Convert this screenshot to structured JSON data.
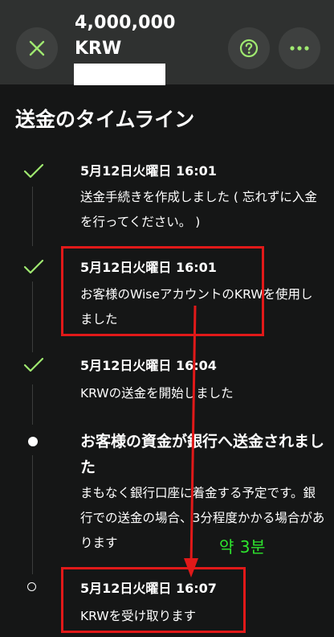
{
  "header": {
    "amount": "4,000,000",
    "currency": "KRW",
    "close_icon": "close-x-icon",
    "help_icon": "question-mark-icon",
    "more_icon": "more-dots-icon",
    "accent_color": "#9fe870"
  },
  "timeline": {
    "title": "送金のタイムライン",
    "steps": [
      {
        "status": "done",
        "time": "5月12日火曜日 16:01",
        "text": "送金手続きを作成しました ( 忘れずに入金を行ってください。 )"
      },
      {
        "status": "done",
        "time": "5月12日火曜日 16:01",
        "text": "お客様のWiseアカウントのKRWを使用しました"
      },
      {
        "status": "done",
        "time": "5月12日火曜日 16:04",
        "text": "KRWの送金を開始しました"
      },
      {
        "status": "current",
        "heading": "お客様の資金が銀行へ送金されました",
        "text": "まもなく銀行口座に着金する予定です。銀行での送金の場合、3分程度かかる場合があります"
      },
      {
        "status": "pending",
        "time": "5月12日火曜日 16:07",
        "text": "KRWを受け取ります"
      }
    ]
  },
  "annotation": {
    "note": "약 3분",
    "color": "#e11919",
    "note_color": "#2ee52e"
  }
}
